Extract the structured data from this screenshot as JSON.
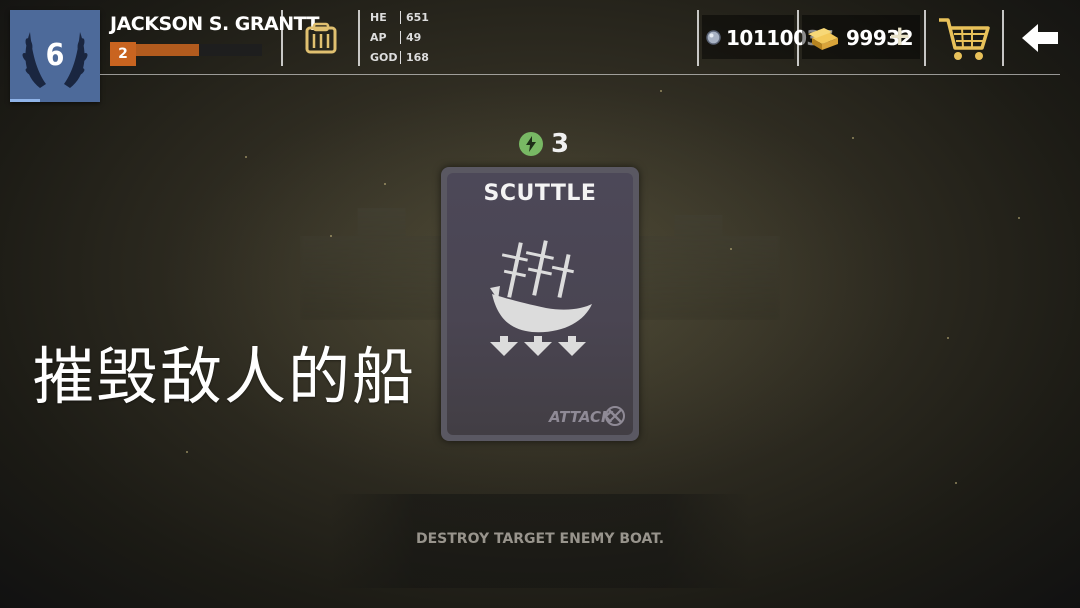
{
  "player": {
    "level": "6",
    "name": "JACKSON S. GRANTT",
    "rank": "2",
    "xp_fraction": 0.5
  },
  "stats": [
    {
      "label": "HE",
      "value": "651"
    },
    {
      "label": "AP",
      "value": "49"
    },
    {
      "label": "GOD",
      "value": "168"
    }
  ],
  "currency": {
    "silver": "10110037",
    "gold": "99932",
    "silver_icon": "silver-coin-icon",
    "gold_icon": "gold-bar-icon"
  },
  "card": {
    "cost": "3",
    "title": "SCUTTLE",
    "type": "ATTACK",
    "art": "sinking-ship-icon"
  },
  "caption": "摧毁敌人的船",
  "description": "DESTROY TARGET ENEMY BOAT.",
  "colors": {
    "badge": "#4d6a9a",
    "rank": "#c96420",
    "energy": "#78b864",
    "gold": "#d8a83a"
  }
}
